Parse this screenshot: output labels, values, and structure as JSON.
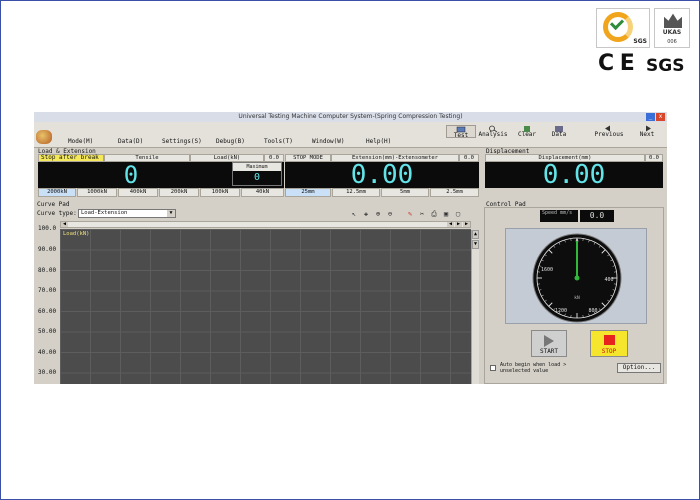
{
  "window": {
    "title": "Universal Testing Machine Computer System-(Spring Compression Testing)",
    "min_glyph": "_",
    "close_glyph": "x"
  },
  "menu": [
    "Mode(M)",
    "Data(D)",
    "Settings(S)",
    "Debug(B)",
    "Tools(T)",
    "Window(W)",
    "Help(H)"
  ],
  "toolbar": [
    {
      "label": "Test",
      "icon": "test-icon"
    },
    {
      "label": "Analysis",
      "icon": "analysis-icon"
    },
    {
      "label": "Clear",
      "icon": "clear-icon"
    },
    {
      "label": "Data",
      "icon": "data-icon"
    },
    {
      "label": "Previous",
      "icon": "previous-icon"
    },
    {
      "label": "Next",
      "icon": "next-icon"
    }
  ],
  "load_extension": {
    "section_label": "Load & Extension",
    "stop_after_break": "Stop after break",
    "tensile_label": "Tensile",
    "load_label": "Load(kN)",
    "load_unit_value": "0.0",
    "load_value": "0",
    "maximum_label": "Maximum",
    "maximum_value": "0",
    "load_ranges": [
      "2000kN",
      "1000kN",
      "400kN",
      "200kN",
      "100kN",
      "40kN"
    ],
    "active_load_range": "2000kN",
    "stop_mode": "STOP MODE",
    "extension_label": "Extension(mm)-Extensometer",
    "extension_unit_value": "0.0",
    "extension_value": "0.00",
    "extension_ranges": [
      "25mm",
      "12.5mm",
      "5mm",
      "2.5mm"
    ],
    "active_extension_range": "25mm"
  },
  "displacement": {
    "section_label": "Displacement",
    "label": "Displacement(mm)",
    "unit_value": "0.0",
    "value": "0.00"
  },
  "curve_pad": {
    "section_label": "Curve Pad",
    "curve_type_label": "Curve type:",
    "curve_type_value": "Load-Extension",
    "series_label": "Load(kN)",
    "y_ticks": [
      "100.0",
      "90.00",
      "80.00",
      "70.00",
      "60.00",
      "50.00",
      "40.00",
      "30.00"
    ]
  },
  "control_pad": {
    "section_label": "Control Pad",
    "speed_label": "Speed mm/s",
    "speed_value": "0.0",
    "gauge_ticks": [
      "0",
      "400",
      "800",
      "1200",
      "1600"
    ],
    "gauge_unit": "kN",
    "start_label": "START",
    "stop_label": "STOP",
    "auto_begin_text": "Auto begin when load > unselected value",
    "options_label": "Option..."
  },
  "logos": {
    "sgs_cert_text": "SGS",
    "ukas_text": "UKAS",
    "ukas_sub": "006",
    "ce_text": "C E",
    "sgs_text": "SGS"
  },
  "colors": {
    "display_text": "#63e4e8",
    "stop_button": "#f5e52c",
    "stop_square": "#e8231d",
    "gauge_needle": "#2fb83a"
  }
}
